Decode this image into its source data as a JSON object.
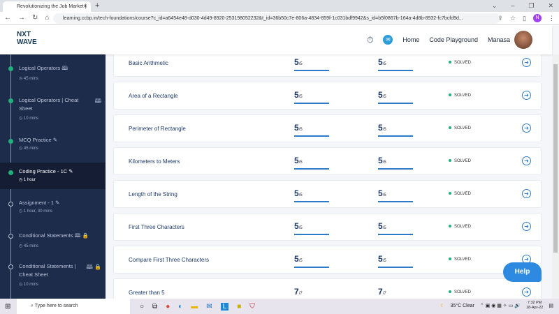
{
  "browser": {
    "tab_title": "Revolutionizing the Job Market |",
    "url": "learning.ccbp.in/tech-foundations/course?c_id=a6454e48-d030-4d49-8920-253198052232&t_id=36b50c7e-806a-4834-859f-1c031bdf9942&s_id=b5f0867b-164a-4d8b-8932-fc7bcfd9d...",
    "profile_initial": "N"
  },
  "header": {
    "logo_line1": "NXT",
    "logo_line2": "WAVE",
    "nav": [
      "Home",
      "Code Playground"
    ],
    "user": "Manasa"
  },
  "sidebar": {
    "items": [
      {
        "title": "Logical Operators",
        "duration": "45 mins",
        "status": "done",
        "icon": "book-icon"
      },
      {
        "title": "Logical Operators | Cheat Sheet",
        "duration": "10 mins",
        "status": "done",
        "icon": "book-icon"
      },
      {
        "title": "MCQ Practice",
        "duration": "45 mins",
        "status": "done",
        "icon": "pencil-icon"
      },
      {
        "title": "Coding Practice - 1C",
        "duration": "1 hour",
        "status": "done",
        "icon": "pencil-icon",
        "active": true
      },
      {
        "title": "Assignment - 1",
        "duration": "1 hour, 30 mins",
        "status": "open",
        "icon": "pencil-icon"
      },
      {
        "title": "Conditional Statements",
        "duration": "45 mins",
        "status": "locked",
        "icon": "book-icon"
      },
      {
        "title": "Conditional Statements | Cheat Sheet",
        "duration": "10 mins",
        "status": "locked",
        "icon": "book-icon"
      }
    ]
  },
  "problems": [
    {
      "title": "Basic Arithmetic",
      "score": "5",
      "total": "/5",
      "score2": "5",
      "total2": "/5",
      "status": "SOLVED"
    },
    {
      "title": "Area of a Rectangle",
      "score": "5",
      "total": "/5",
      "score2": "5",
      "total2": "/5",
      "status": "SOLVED"
    },
    {
      "title": "Perimeter of Rectangle",
      "score": "5",
      "total": "/5",
      "score2": "5",
      "total2": "/5",
      "status": "SOLVED"
    },
    {
      "title": "Kilometers to Meters",
      "score": "5",
      "total": "/5",
      "score2": "5",
      "total2": "/5",
      "status": "SOLVED"
    },
    {
      "title": "Length of the String",
      "score": "5",
      "total": "/5",
      "score2": "5",
      "total2": "/5",
      "status": "SOLVED"
    },
    {
      "title": "First Three Characters",
      "score": "5",
      "total": "/5",
      "score2": "5",
      "total2": "/5",
      "status": "SOLVED"
    },
    {
      "title": "Compare First Three Characters",
      "score": "5",
      "total": "/5",
      "score2": "5",
      "total2": "/5",
      "status": "SOLVED"
    },
    {
      "title": "Greater than 5",
      "score": "7",
      "total": "/7",
      "score2": "7",
      "total2": "/7",
      "status": "SOLVED"
    }
  ],
  "help_label": "Help",
  "taskbar": {
    "search_placeholder": "Type here to search",
    "weather": "35°C  Clear",
    "time": "7:32 PM",
    "date": "18-Apr-22"
  }
}
